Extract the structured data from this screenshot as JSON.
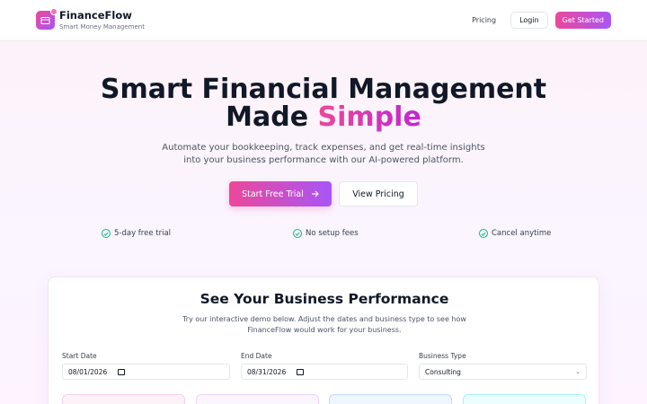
{
  "header": {
    "brand_name": "FinanceFlow",
    "brand_tagline": "Smart Money Management",
    "nav_pricing": "Pricing",
    "nav_login": "Login",
    "nav_get_started": "Get Started"
  },
  "hero": {
    "title_line1": "Smart Financial Management",
    "title_line2_prefix": "Made",
    "title_line2_accent": "Simple",
    "subtitle": "Automate your bookkeeping, track expenses, and get real-time insights into your business performance with our AI-powered platform.",
    "cta_primary": "Start Free Trial",
    "cta_secondary": "View Pricing",
    "features": [
      "5-day free trial",
      "No setup fees",
      "Cancel anytime"
    ]
  },
  "demo": {
    "title": "See Your Business Performance",
    "subtitle": "Try our interactive demo below. Adjust the dates and business type to see how FinanceFlow would work for your business.",
    "start_date_label": "Start Date",
    "start_date_value": "08/01/2026",
    "end_date_label": "End Date",
    "end_date_value": "08/31/2026",
    "business_type_label": "Business Type",
    "business_type_value": "Consulting"
  },
  "colors": {
    "accent_pink": "#ec4899",
    "accent_purple": "#a855f7",
    "check_green": "#10b981"
  }
}
